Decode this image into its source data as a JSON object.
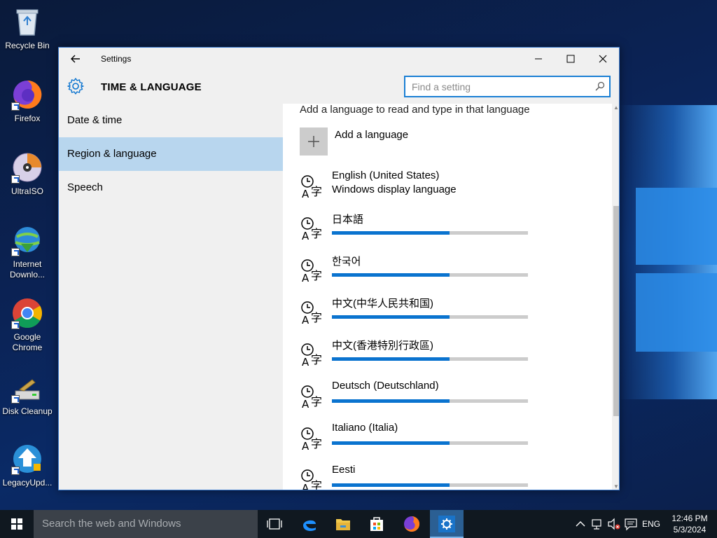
{
  "desktop": {
    "icons": [
      {
        "label": "Recycle Bin"
      },
      {
        "label": "Firefox"
      },
      {
        "label": "UltraISO"
      },
      {
        "label": "Internet Downlo..."
      },
      {
        "label": "Google Chrome"
      },
      {
        "label": "Disk Cleanup"
      },
      {
        "label": "LegacyUpd..."
      }
    ]
  },
  "window": {
    "title": "Settings",
    "back_icon": "back-arrow-icon",
    "controls": {
      "minimize": "—",
      "maximize": "☐",
      "close": "✕"
    }
  },
  "header": {
    "icon": "gear-icon",
    "title": "TIME & LANGUAGE",
    "search_placeholder": "Find a setting"
  },
  "nav": {
    "items": [
      {
        "label": "Date & time",
        "active": false
      },
      {
        "label": "Region & language",
        "active": true
      },
      {
        "label": "Speech",
        "active": false
      }
    ]
  },
  "content": {
    "intro": "Add a language to read and type in that language",
    "add_language": "Add a language",
    "languages": [
      {
        "name": "English (United States)",
        "sub": "Windows display language"
      },
      {
        "name": "日本語",
        "progress": 0.6
      },
      {
        "name": "한국어",
        "progress": 0.6
      },
      {
        "name": "中文(中华人民共和国)",
        "progress": 0.6
      },
      {
        "name": "中文(香港特別行政區)",
        "progress": 0.6
      },
      {
        "name": "Deutsch (Deutschland)",
        "progress": 0.6
      },
      {
        "name": "Italiano (Italia)",
        "progress": 0.6
      },
      {
        "name": "Eesti",
        "progress": 0.6
      }
    ]
  },
  "taskbar": {
    "search_placeholder": "Search the web and Windows",
    "input_language": "ENG",
    "time": "12:46 PM",
    "date": "5/3/2024",
    "accent": "#0a73cf"
  }
}
